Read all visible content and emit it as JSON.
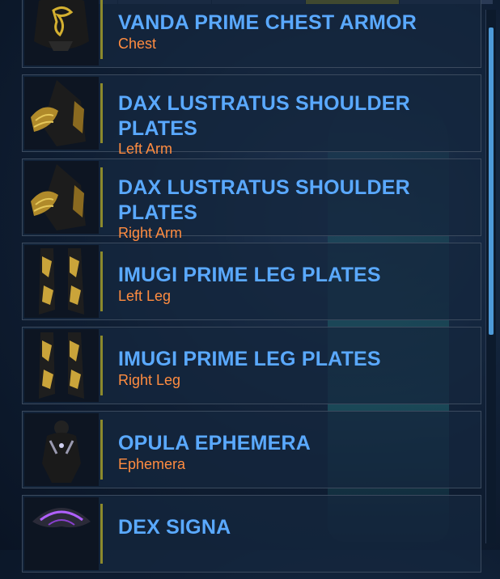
{
  "items": [
    {
      "title": "VANDA PRIME CHEST ARMOR",
      "slot": "Chest",
      "icon": "chest-armor-icon"
    },
    {
      "title": "DAX LUSTRATUS SHOULDER PLATES",
      "slot": "Left Arm",
      "icon": "shoulder-plate-icon"
    },
    {
      "title": "DAX LUSTRATUS SHOULDER PLATES",
      "slot": "Right Arm",
      "icon": "shoulder-plate-icon"
    },
    {
      "title": "IMUGI PRIME LEG PLATES",
      "slot": "Left Leg",
      "icon": "leg-plates-icon"
    },
    {
      "title": "IMUGI PRIME LEG PLATES",
      "slot": "Right Leg",
      "icon": "leg-plates-icon"
    },
    {
      "title": "OPULA EPHEMERA",
      "slot": "Ephemera",
      "icon": "ephemera-icon"
    },
    {
      "title": "DEX SIGNA",
      "slot": "",
      "icon": "signa-icon"
    }
  ],
  "colors": {
    "title": "#5aa9ff",
    "slot": "#ff8c40",
    "separator": "#8c8a2c",
    "active_tab": "#d8c400",
    "scroll_thumb": "#4d9ad8"
  }
}
